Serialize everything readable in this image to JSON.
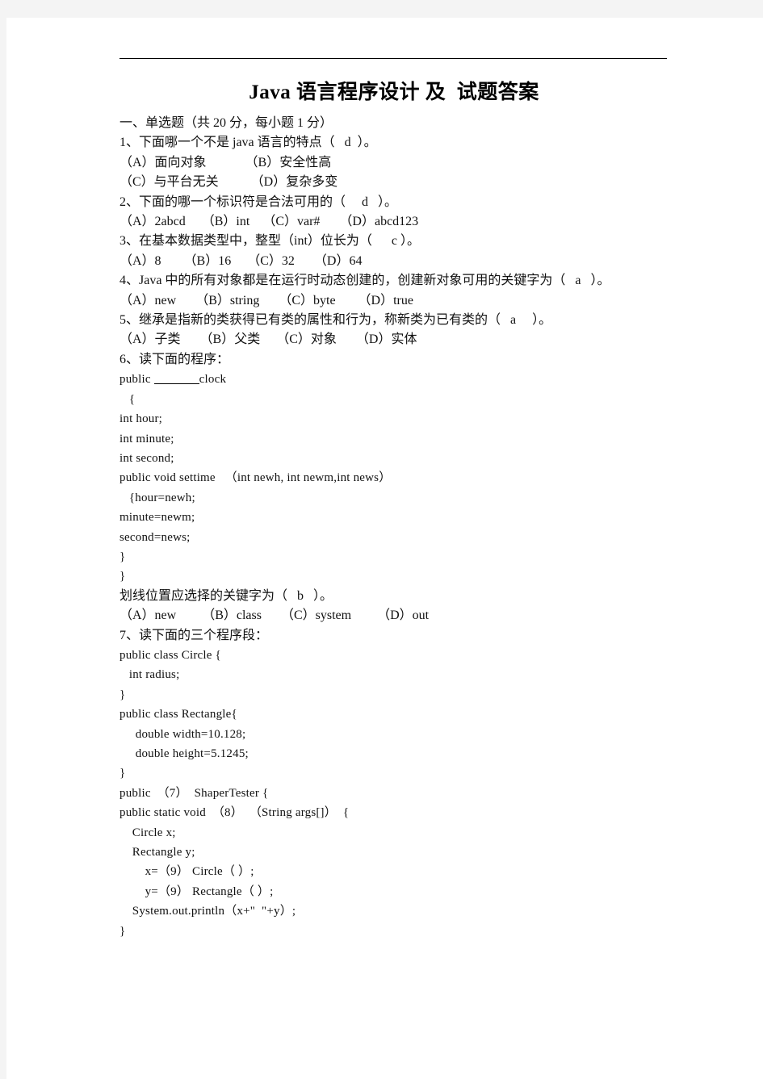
{
  "document": {
    "title": "Java 语言程序设计 及  试题答案",
    "section_heading": "一、单选题（共 20 分，每小题 1 分）",
    "questions": [
      {
        "stem": "1、下面哪一个不是 java 语言的特点（   d  ）。",
        "options": [
          "（A）面向对象            （B）安全性高",
          "（C）与平台无关          （D）复杂多变"
        ]
      },
      {
        "stem": "2、下面的哪一个标识符是合法可用的（     d   ）。",
        "options": [
          "（A）2abcd     （B）int    （C）var#      （D）abcd123"
        ]
      },
      {
        "stem": "3、在基本数据类型中，整型（int）位长为（      c ）。",
        "options": [
          "（A）8       （B）16     （C）32      （D）64"
        ]
      },
      {
        "stem": "4、Java 中的所有对象都是在运行时动态创建的，创建新对象可用的关键字为（   a   ）。",
        "options": [
          "（A）new      （B）string      （C）byte       （D）true"
        ]
      },
      {
        "stem": "5、继承是指新的类获得已有类的属性和行为，称新类为已有类的（   a     ）。",
        "options": [
          "（A）子类      （B）父类     （C）对象      （D）实体"
        ]
      }
    ],
    "q6": {
      "stem": "6、读下面的程序：",
      "code_prefix": "public ",
      "code_suffix": "clock",
      "code_lines": [
        "   {",
        "int hour;",
        "int minute;",
        "int second;",
        "public void settime   （int newh, int newm,int news）",
        "   {hour=newh;",
        "minute=newm;",
        "second=news;",
        "}",
        "}"
      ],
      "question_line": "划线位置应选择的关键字为（   b   ）。",
      "options": [
        "（A）new        （B）class      （C）system        （D）out"
      ]
    },
    "q7": {
      "stem": "7、读下面的三个程序段：",
      "code_lines": [
        "public class Circle {",
        "   int radius;",
        "}",
        "public class Rectangle{",
        "     double width=10.128;",
        "     double height=5.1245;",
        "}",
        "public  （7）  ShaperTester {",
        "public static void  （8）  （String args[]）  {",
        "    Circle x;",
        "    Rectangle y;",
        "        x=（9） Circle（ ）;",
        "        y=（9） Rectangle（ ）;",
        "    System.out.println（x+\"  \"+y）;",
        "}"
      ]
    }
  }
}
